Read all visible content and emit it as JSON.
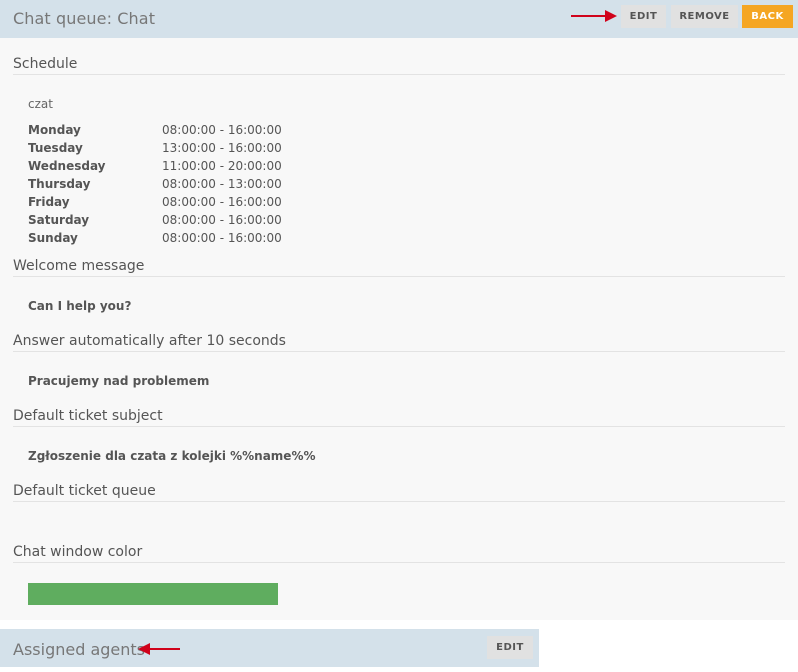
{
  "header": {
    "title": "Chat queue: Chat",
    "edit_label": "EDIT",
    "remove_label": "REMOVE",
    "back_label": "BACK"
  },
  "sections": {
    "schedule": {
      "title": "Schedule",
      "name": "czat",
      "days": [
        {
          "day": "Monday",
          "hours": "08:00:00 - 16:00:00"
        },
        {
          "day": "Tuesday",
          "hours": "13:00:00 - 16:00:00"
        },
        {
          "day": "Wednesday",
          "hours": "11:00:00 - 20:00:00"
        },
        {
          "day": "Thursday",
          "hours": "08:00:00 - 13:00:00"
        },
        {
          "day": "Friday",
          "hours": "08:00:00 - 16:00:00"
        },
        {
          "day": "Saturday",
          "hours": "08:00:00 - 16:00:00"
        },
        {
          "day": "Sunday",
          "hours": "08:00:00 - 16:00:00"
        }
      ]
    },
    "welcome": {
      "title": "Welcome message",
      "value": "Can I help you?"
    },
    "auto_answer": {
      "title": "Answer automatically after 10 seconds",
      "value": "Pracujemy nad problemem"
    },
    "ticket_subject": {
      "title": "Default ticket subject",
      "value": "Zgłoszenie dla czata z kolejki %%name%%"
    },
    "ticket_queue": {
      "title": "Default ticket queue"
    },
    "chat_color": {
      "title": "Chat window color",
      "color": "#5fad5f"
    }
  },
  "agents": {
    "title": "Assigned agents",
    "edit_label": "EDIT"
  },
  "colors": {
    "header_bg": "#d4e1ea",
    "back_button": "#f5a623",
    "arrow": "#d0021b"
  }
}
